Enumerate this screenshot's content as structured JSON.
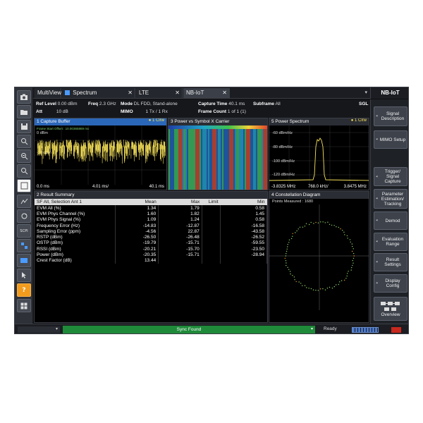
{
  "tabs": [
    {
      "label": "MultiView"
    },
    {
      "label": "Spectrum"
    },
    {
      "label": "LTE"
    },
    {
      "label": "NB-IoT"
    }
  ],
  "side_header": "NB-IoT",
  "info": {
    "ref_level_label": "Ref Level",
    "ref_level": "0.00 dBm",
    "freq_label": "Freq",
    "freq": "2.3 GHz",
    "mode_label": "Mode",
    "mode": "DL FDD, Stand-alone",
    "capture_time_label": "Capture Time",
    "capture_time": "40.1 ms",
    "subframe_label": "Subframe",
    "subframe": "All",
    "sgl": "SGL",
    "att_label": "Att",
    "att": "10 dB",
    "mimo_label": "MIMO",
    "mimo": "1 Tx / 1 Rx",
    "frame_count_label": "Frame Count",
    "frame_count": "1 of 1 (1)"
  },
  "panels": {
    "capture": {
      "title": "1 Capture Buffer",
      "trace": "● 1 Clrw",
      "y_top": "0 dBm",
      "y_mid": "-20 dBm",
      "x_start": "0.0 ms",
      "x_mid": "4.01 ms/",
      "x_end": "40.1 ms",
      "offset": "Frame Start Offset : 10.00365869 ms"
    },
    "power": {
      "title": "3 Power vs Symbol X Carrier"
    },
    "spectrum": {
      "title": "5 Power Spectrum",
      "trace": "● 1 Clrw",
      "y1": "-60 dBm/Hz",
      "y2": "-80 dBm/Hz",
      "y3": "-100 dBm/Hz",
      "y4": "-120 dBm/Hz",
      "x_start": "-3.8325 MHz",
      "x_mid": "768.0 kHz/",
      "x_end": "3.8475 MHz"
    },
    "result": {
      "title": "2 Result Summary",
      "headers": [
        "SF  All, Selection  Ant 1",
        "Mean",
        "Max",
        "Limit",
        "Min"
      ],
      "rows": [
        [
          "EVM All (%)",
          "1.34",
          "1.79",
          "",
          "0.58"
        ],
        [
          "EVM Phys Channel (%)",
          "1.60",
          "1.82",
          "",
          "1.45"
        ],
        [
          "EVM Phys Signal (%)",
          "1.09",
          "1.24",
          "",
          "0.58"
        ],
        [
          "Frequency Error (Hz)",
          "-14.83",
          "-12.87",
          "",
          "-16.58"
        ],
        [
          "Sampling Error (ppm)",
          "-4.56",
          "22.87",
          "",
          "-43.58"
        ],
        [
          "RSTP (dBm)",
          "-26.50",
          "-26.48",
          "",
          "-26.52"
        ],
        [
          "OSTP (dBm)",
          "-19.79",
          "-15.71",
          "",
          "-59.55"
        ],
        [
          "RSSI (dBm)",
          "-20.21",
          "-15.70",
          "",
          "-23.50"
        ],
        [
          "Power (dBm)",
          "-20.35",
          "-15.71",
          "",
          "-28.94"
        ],
        [
          "Crest Factor (dB)",
          "13.44",
          "",
          "",
          ""
        ]
      ]
    },
    "constellation": {
      "title": "4 Constellation Diagram",
      "points_measured": "Points Measured : 1680"
    }
  },
  "softkeys": [
    {
      "label": "Signal Description"
    },
    {
      "label": "MIMO Setup"
    },
    {
      "label": "Trigger/ Signal Capture"
    },
    {
      "label": "Parameter Estimation/ Tracking"
    },
    {
      "label": "Demod"
    },
    {
      "label": "Evaluation Range"
    },
    {
      "label": "Result Settings"
    },
    {
      "label": "Display Config"
    },
    {
      "label": "Overview"
    }
  ],
  "status": {
    "sync": "Sync Found",
    "ready": "Ready"
  },
  "toolbar_icons": [
    "camera-icon",
    "open-folder-icon",
    "save-icon",
    "zoom-icon",
    "multi-zoom-icon",
    "zoom-out-icon",
    "zoom-reset-icon",
    "marker-icon",
    "display-layout-icon",
    "refresh-icon",
    "scpi-icon",
    "sequencer-icon",
    "screen-icon",
    "help-pointer-icon",
    "help-icon",
    "windows-icon"
  ],
  "colors": {
    "trace_yellow": "#f7e25a",
    "title_blue": "#2b67b8",
    "sync_green": "#1f8a3a",
    "help_orange": "#f29b1d"
  }
}
